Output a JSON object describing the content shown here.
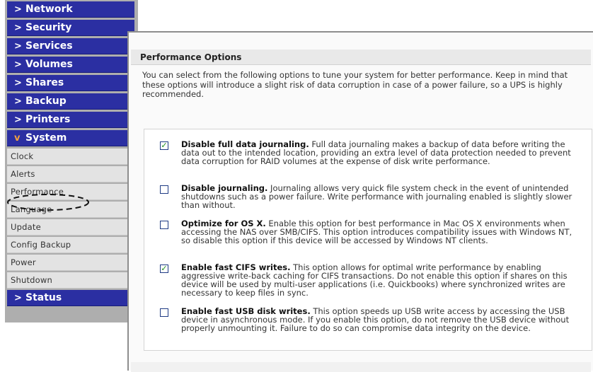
{
  "sidebar": {
    "main_items": [
      {
        "label": "Network"
      },
      {
        "label": "Security"
      },
      {
        "label": "Services"
      },
      {
        "label": "Volumes"
      },
      {
        "label": "Shares"
      },
      {
        "label": "Backup"
      },
      {
        "label": "Printers"
      },
      {
        "label": "System"
      }
    ],
    "sub_items": [
      {
        "label": "Clock"
      },
      {
        "label": "Alerts"
      },
      {
        "label": "Performance"
      },
      {
        "label": "Language"
      },
      {
        "label": "Update"
      },
      {
        "label": "Config Backup"
      },
      {
        "label": "Power"
      },
      {
        "label": "Shutdown"
      }
    ],
    "status_item": {
      "label": "Status"
    },
    "collapsed_chevron": ">",
    "expanded_chevron": "v"
  },
  "panel": {
    "title": "Performance Options",
    "intro": "You can select from the following options to tune your system for better performance. Keep in mind that these options will introduce a slight risk of data corruption in case of a power failure, so a UPS is highly recommended.",
    "options": [
      {
        "title": "Disable full data journaling.",
        "desc": " Full data journaling makes a backup of data before writing the data out to the intended location, providing an extra level of data protection needed to prevent data corruption for RAID volumes at the expense of disk write performance.",
        "checked": true
      },
      {
        "title": "Disable journaling.",
        "desc": " Journaling allows very quick file system check in the event of unintended shutdowns such as a power failure. Write performance with journaling enabled is slightly slower than without.",
        "checked": false
      },
      {
        "title": "Optimize for OS X.",
        "desc": " Enable this option for best performance in Mac OS X environments when accessing the NAS over SMB/CIFS. This option introduces compatibility issues with Windows NT, so disable this option if this device will be accessed by Windows NT clients.",
        "checked": false
      },
      {
        "title": "Enable fast CIFS writes.",
        "desc": " This option allows for optimal write performance by enabling aggressive write-back caching for CIFS transactions. Do not enable this option if shares on this device will be used by multi-user applications (i.e. Quickbooks) where synchronized writes are necessary to keep files in sync.",
        "checked": true
      },
      {
        "title": "Enable fast USB disk writes.",
        "desc": " This option speeds up USB write access by accessing the USB device in asynchronous mode. If you enable this option, do not remove the USB device without properly unmounting it. Failure to do so can compromise data integrity on the device.",
        "checked": false
      }
    ],
    "check_glyph": "✓"
  },
  "colors": {
    "nav_blue": "#2b2fa2",
    "sub_gray": "#e3e3e3",
    "check_green": "#1b8f1b"
  }
}
